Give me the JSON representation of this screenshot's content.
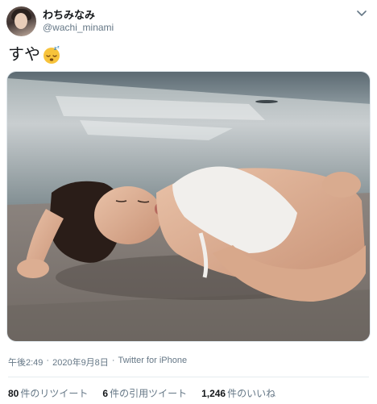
{
  "author": {
    "display_name": "わちみなみ",
    "handle": "@wachi_minami"
  },
  "tweet": {
    "text": "すや",
    "emoji": "sleeping-face"
  },
  "meta": {
    "time": "午後2:49",
    "separator1": "·",
    "date": "2020年9月8日",
    "separator2": "·",
    "source": "Twitter for iPhone"
  },
  "stats": {
    "retweets": {
      "count": "80",
      "label": "件のリツイート"
    },
    "quotes": {
      "count": "6",
      "label": "件の引用ツイート"
    },
    "likes": {
      "count": "1,246",
      "label": "件のいいね"
    }
  },
  "colors": {
    "text_primary": "#14171a",
    "text_secondary": "#657786",
    "divider": "#e6ecf0"
  }
}
